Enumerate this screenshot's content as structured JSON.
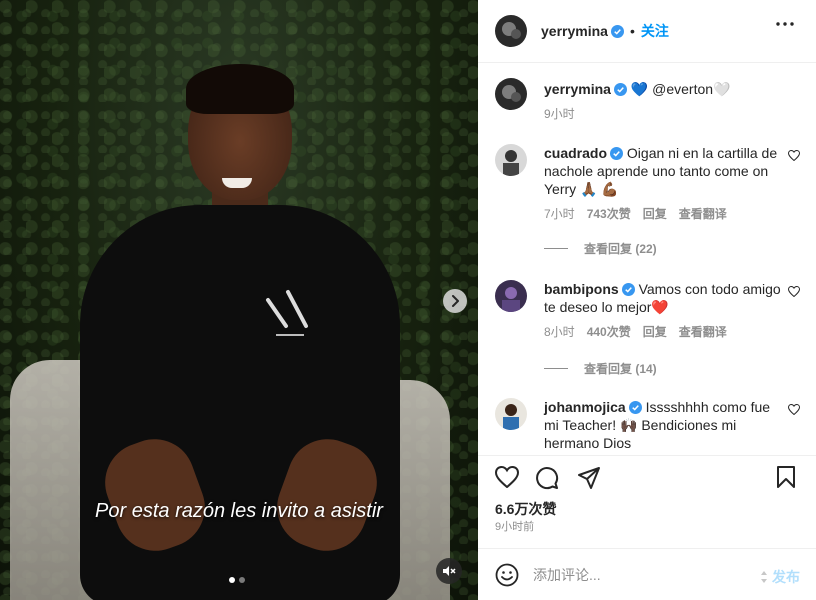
{
  "media": {
    "subtitle": "Por esta razón les invito a asistir",
    "carousel_dots": 2,
    "active_dot": 0
  },
  "post": {
    "username": "yerrymina",
    "separator": "•",
    "follow_label": "关注",
    "caption": {
      "username": "yerrymina",
      "text": "💙 @everton🤍",
      "time": "9小时"
    }
  },
  "comments": [
    {
      "username": "cuadrado",
      "text": "Oigan ni en la cartilla de nachole aprende uno tanto come on Yerry 🙏🏾 💪🏾",
      "time": "7小时",
      "likes": "743次赞",
      "reply": "回复",
      "translate": "查看翻译",
      "view_replies": "查看回复 (22)"
    },
    {
      "username": "bambipons",
      "text": "Vamos con todo amigo te deseo lo mejor❤️",
      "time": "8小时",
      "likes": "440次赞",
      "reply": "回复",
      "translate": "查看翻译",
      "view_replies": "查看回复 (14)"
    },
    {
      "username": "johanmojica",
      "text": "Isssshhhh como fue mi Teacher! 🙌🏿 Bendiciones mi hermano Dios"
    }
  ],
  "footer": {
    "likes": "6.6万次赞",
    "time_ago": "9小时前",
    "comment_placeholder": "添加评论...",
    "post_label": "发布"
  },
  "colors": {
    "accent": "#0095f6",
    "verified": "#3897f0",
    "muted": "#8e8e8e",
    "border": "#efefef"
  },
  "icons": [
    "chevron-right-icon",
    "mute-icon",
    "more-icon",
    "verified-icon",
    "heart-icon",
    "comment-icon",
    "share-icon",
    "bookmark-icon",
    "emoji-icon"
  ]
}
